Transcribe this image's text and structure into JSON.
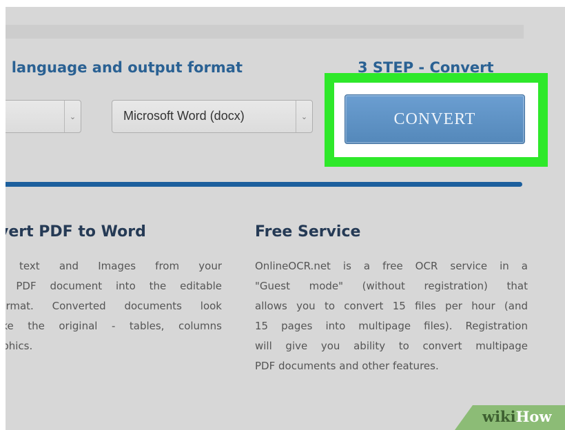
{
  "steps": {
    "step2_heading": ": language and output format",
    "step3_heading": "3 STEP - Convert"
  },
  "selects": {
    "language_value": "",
    "format_value": "Microsoft Word (docx)"
  },
  "convert_button": {
    "label": "CONVERT"
  },
  "highlight_color": "#2ee82a",
  "info": {
    "left_title": "vert PDF to Word",
    "left_lines": [
      "t text and Images from your",
      "d PDF document into the editable",
      "format. Converted documents look",
      " like the original - tables, columns",
      "aphics."
    ],
    "right_title": "Free Service",
    "right_lines": [
      "OnlineOCR.net is a free OCR service in a",
      "\"Guest mode\" (without registration) that",
      "allows you to convert 15 files per hour (and",
      "15 pages into multipage files). Registration",
      "will give you ability to convert multipage",
      "PDF documents and other features."
    ]
  },
  "watermark": {
    "wiki": "wiki",
    "how": "How"
  }
}
